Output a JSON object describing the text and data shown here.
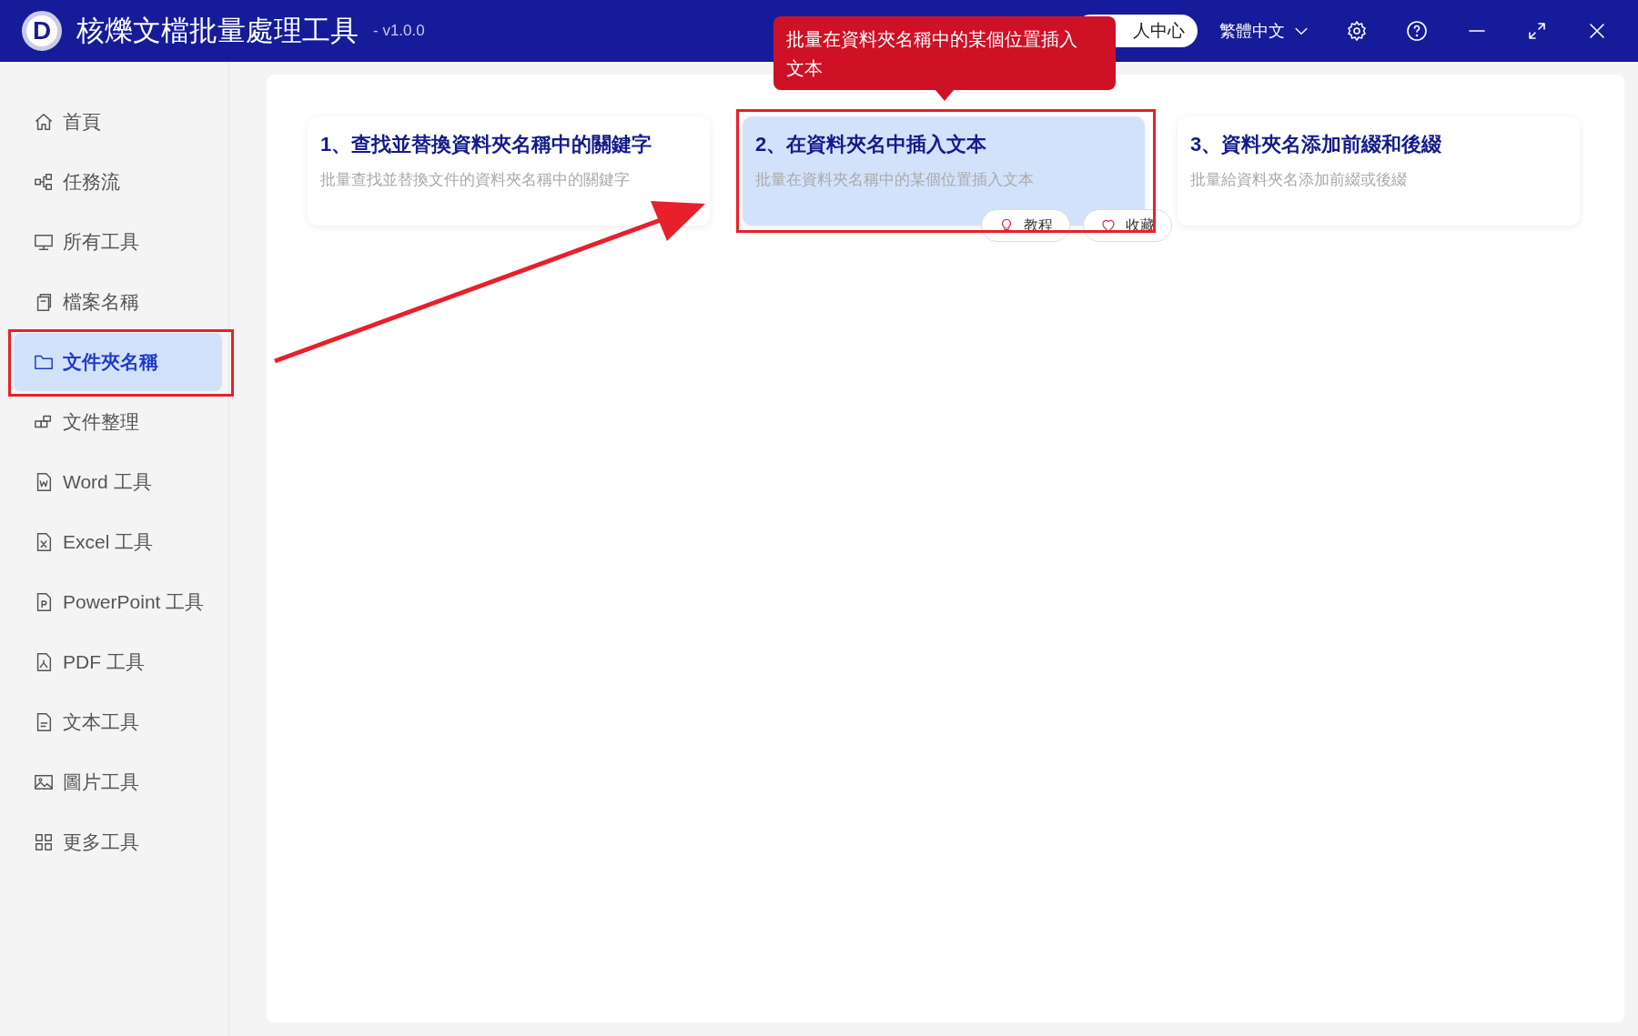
{
  "window": {
    "logo": "D",
    "title": "核爍文檔批量處理工具",
    "version": "- v1.0.0"
  },
  "header": {
    "user_button": "人中心",
    "language": "繁體中文"
  },
  "sidebar": {
    "items": [
      {
        "label": "首頁",
        "selected": false
      },
      {
        "label": "任務流",
        "selected": false
      },
      {
        "label": "所有工具",
        "selected": false
      },
      {
        "label": "檔案名稱",
        "selected": false
      },
      {
        "label": "文件夾名稱",
        "selected": true
      },
      {
        "label": "文件整理",
        "selected": false
      },
      {
        "label": "Word 工具",
        "selected": false
      },
      {
        "label": "Excel 工具",
        "selected": false
      },
      {
        "label": "PowerPoint 工具",
        "selected": false
      },
      {
        "label": "PDF 工具",
        "selected": false
      },
      {
        "label": "文本工具",
        "selected": false
      },
      {
        "label": "圖片工具",
        "selected": false
      },
      {
        "label": "更多工具",
        "selected": false
      }
    ]
  },
  "tooltip": "批量在資料夾名稱中的某個位置插入文本",
  "cards": [
    {
      "title": "1、查找並替換資料夾名稱中的關鍵字",
      "description": "批量查找並替換文件的資料夾名稱中的關鍵字",
      "selected": false
    },
    {
      "title": "2、在資料夾名中插入文本",
      "description": "批量在資料夾名稱中的某個位置插入文本",
      "selected": true
    },
    {
      "title": "3、資料夾名添加前綴和後綴",
      "description": "批量給資料夾名添加前綴或後綴",
      "selected": false
    }
  ],
  "card_actions": [
    "教程",
    "收藏"
  ]
}
